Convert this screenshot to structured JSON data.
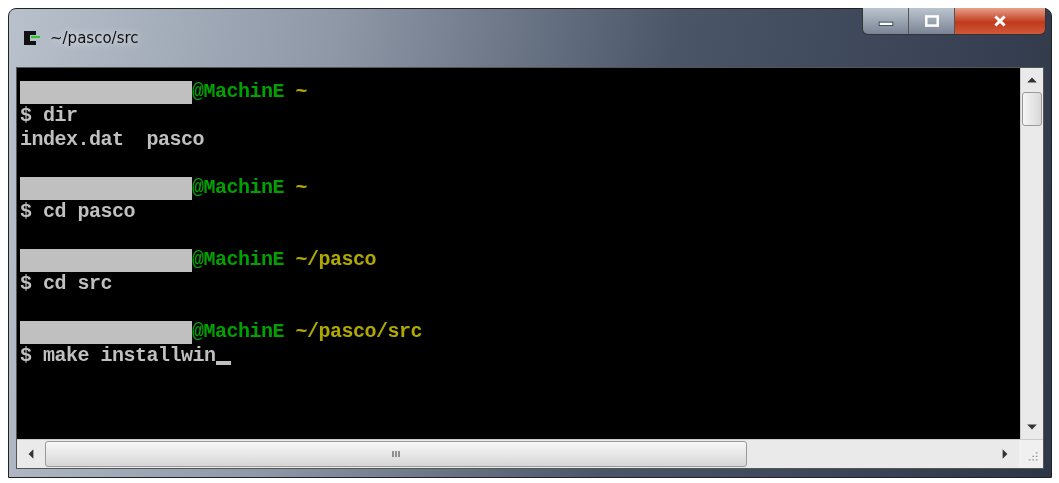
{
  "window": {
    "title": "~/pasco/src"
  },
  "terminal": {
    "cursor": true,
    "lines": [
      {
        "kind": "prompt",
        "host": "@MachinE",
        "path": "~"
      },
      {
        "kind": "command",
        "text": "$ dir"
      },
      {
        "kind": "output",
        "text": "index.dat  pasco"
      },
      {
        "kind": "blank"
      },
      {
        "kind": "prompt",
        "host": "@MachinE",
        "path": "~"
      },
      {
        "kind": "command",
        "text": "$ cd pasco"
      },
      {
        "kind": "blank"
      },
      {
        "kind": "prompt",
        "host": "@MachinE",
        "path": "~/pasco"
      },
      {
        "kind": "command",
        "text": "$ cd src"
      },
      {
        "kind": "blank"
      },
      {
        "kind": "prompt",
        "host": "@MachinE",
        "path": "~/pasco/src"
      },
      {
        "kind": "command",
        "text": "$ make installwin"
      }
    ]
  }
}
